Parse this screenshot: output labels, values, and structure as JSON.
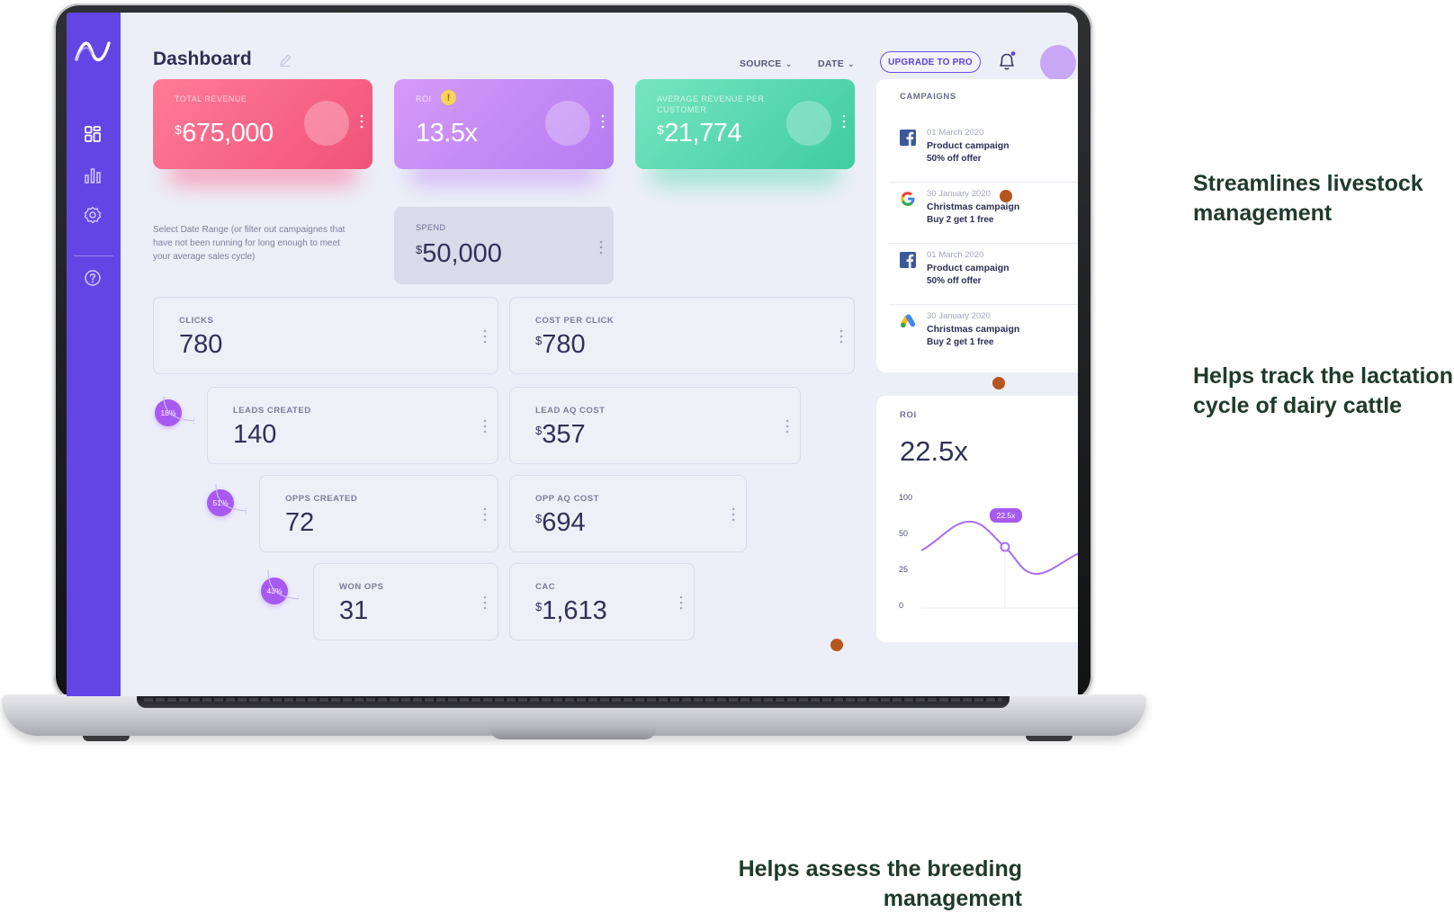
{
  "app": {
    "page_title": "Dashboard",
    "source_label": "SOURCE",
    "date_label": "DATE",
    "upgrade_label": "UPGRADE TO PRO"
  },
  "kpis": {
    "total_revenue": {
      "label": "TOTAL REVENUE",
      "currency": "$",
      "value": "675,000"
    },
    "roi": {
      "label": "ROI",
      "warning": "!",
      "value": "13.5x"
    },
    "avg_revenue": {
      "label": "AVERAGE REVENUE PER CUSTOMER",
      "currency": "$",
      "value": "21,774"
    }
  },
  "date_note": "Select Date Range (or filter out campaignes that have not been running for long enough to meet your average sales cycle)",
  "spend": {
    "label": "SPEND",
    "currency": "$",
    "value": "50,000"
  },
  "funnel": {
    "clicks": {
      "label": "CLICKS",
      "value": "780"
    },
    "cost_per_click": {
      "label": "COST PER CLICK",
      "currency": "$",
      "value": "780"
    },
    "leads_created": {
      "label": "LEADS CREATED",
      "value": "140"
    },
    "lead_aq_cost": {
      "label": "LEAD AQ COST",
      "currency": "$",
      "value": "357"
    },
    "opps_created": {
      "label": "OPPS CREATED",
      "value": "72"
    },
    "opp_aq_cost": {
      "label": "OPP AQ COST",
      "currency": "$",
      "value": "694"
    },
    "won_ops": {
      "label": "WON OPS",
      "value": "31"
    },
    "cac": {
      "label": "CAC",
      "currency": "$",
      "value": "1,613"
    },
    "pct_leads": "18%",
    "pct_opps": "51%",
    "pct_won": "43%"
  },
  "campaigns": {
    "title": "CAMPAIGNS",
    "items": [
      {
        "icon": "facebook-icon",
        "date": "01 March 2020",
        "name": "Product campaign",
        "offer": "50% off offer"
      },
      {
        "icon": "google-icon",
        "date": "30 January 2020",
        "name": "Christmas campaign",
        "offer": "Buy 2 get 1 free"
      },
      {
        "icon": "facebook-icon",
        "date": "01 March 2020",
        "name": "Product campaign",
        "offer": "50% off offer"
      },
      {
        "icon": "google-ads-icon",
        "date": "30 January 2020",
        "name": "Christmas campaign",
        "offer": "Buy 2 get 1 free"
      }
    ]
  },
  "roi_panel": {
    "label": "ROI",
    "value": "22.5x",
    "tooltip": "22.5x",
    "y_ticks": [
      "100",
      "50",
      "25",
      "0"
    ]
  },
  "callouts": {
    "livestock": "Streamlines livestock management",
    "lactation": "Helps track the lactation cycle of dairy cattle",
    "breeding": "Helps assess the breeding management"
  },
  "colors": {
    "sidebar": "#6246e5",
    "callout_line": "#b5561f",
    "accent": "#a85af0"
  }
}
